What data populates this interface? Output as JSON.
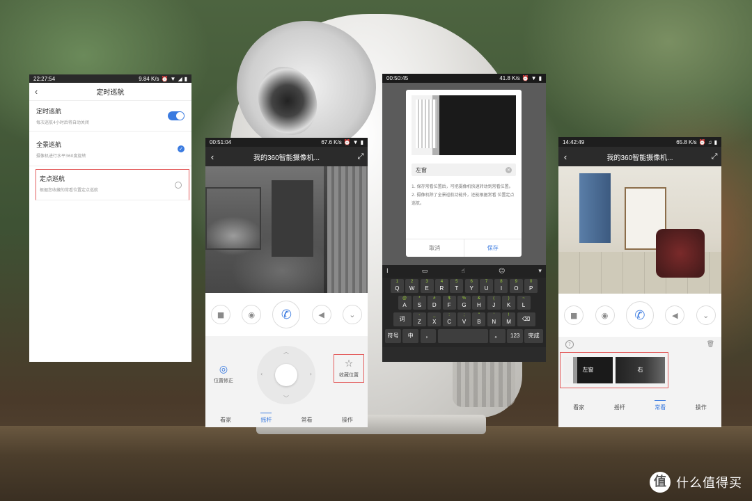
{
  "phone1": {
    "status": {
      "time": "22:27:54",
      "speed": "9.84 K/s"
    },
    "title": "定时巡航",
    "back_icon": "chevron-left-icon",
    "rows": [
      {
        "label": "定时巡航",
        "sub": "每次巡航4小时后将自动关闭"
      },
      {
        "label": "全景巡航",
        "sub": "摄像机进行水平360度旋转"
      },
      {
        "label": "定点巡航",
        "sub": "根据您收藏的常看位置定点巡航"
      }
    ],
    "toggle_on": true,
    "selected_row": "全景巡航",
    "highlight_row": "定点巡航"
  },
  "phone2": {
    "status": {
      "time": "00:51:04",
      "speed": "67.6 K/s"
    },
    "title": "我的360智能摄像机...",
    "controls": [
      "video-icon",
      "camera-icon",
      "phone-icon",
      "volume-icon",
      "chevron-down-icon"
    ],
    "left_action": "位置修正",
    "right_action": "收藏位置",
    "tabs": [
      "看家",
      "摇杆",
      "常看",
      "操作"
    ],
    "active_tab": "摇杆"
  },
  "phone3": {
    "status": {
      "time": "00:50:45",
      "speed": "41.8 K/s"
    },
    "dialog": {
      "input_value": "左窗",
      "tip1": "1. 保存常看位置后，可把摄像机快速转动到常看位置。",
      "tip2": "2. 摄像机除了全景巡航功能外，还能根据常看 位置定点巡航。",
      "cancel": "取消",
      "save": "保存"
    },
    "keyboard": {
      "row1": [
        [
          "Q",
          "1"
        ],
        [
          "W",
          "2"
        ],
        [
          "E",
          "3"
        ],
        [
          "R",
          "4"
        ],
        [
          "T",
          "5"
        ],
        [
          "Y",
          "6"
        ],
        [
          "U",
          "7"
        ],
        [
          "I",
          "8"
        ],
        [
          "O",
          "9"
        ],
        [
          "P",
          "0"
        ]
      ],
      "row2": [
        [
          "A",
          "@"
        ],
        [
          "S",
          "*"
        ],
        [
          "D",
          "#"
        ],
        [
          "F",
          "$"
        ],
        [
          "G",
          "%"
        ],
        [
          "H",
          "&"
        ],
        [
          "J",
          "("
        ],
        [
          "K",
          ")"
        ],
        [
          "L",
          "~"
        ]
      ],
      "row3": [
        [
          "词",
          ""
        ],
        [
          "Z",
          "-"
        ],
        [
          "X",
          "_"
        ],
        [
          "C",
          ":"
        ],
        [
          "V",
          ";"
        ],
        [
          "B",
          "\""
        ],
        [
          "N",
          "'"
        ],
        [
          "M",
          "!"
        ],
        [
          "⌫",
          ""
        ]
      ],
      "row4": {
        "symbols": "符号",
        "zh": "中",
        "comma": "，",
        "period": "。",
        "num": "123",
        "done": "完成"
      }
    }
  },
  "phone4": {
    "status": {
      "time": "14:42:49",
      "speed": "65.8 K/s"
    },
    "title": "我的360智能摄像机...",
    "controls": [
      "video-icon",
      "camera-icon",
      "phone-icon",
      "volume-icon",
      "chevron-down-icon"
    ],
    "presets": [
      "左窗",
      "右"
    ],
    "tabs": [
      "看家",
      "摇杆",
      "常看",
      "操作"
    ],
    "active_tab": "常看"
  },
  "watermark": {
    "logo": "值",
    "text": "什么值得买"
  },
  "colors": {
    "accent": "#3b7be0",
    "highlight": "#e35b5b",
    "key_symbol": "#9ccf3c"
  }
}
